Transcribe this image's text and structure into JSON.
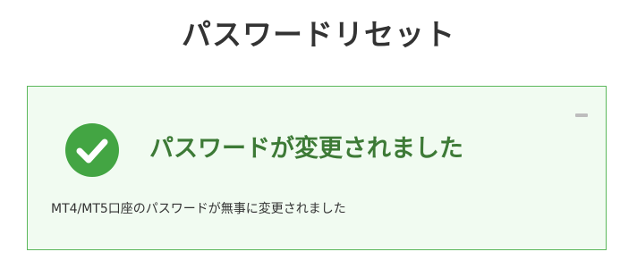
{
  "page": {
    "title": "パスワードリセット"
  },
  "alert": {
    "status": "success",
    "icon": "check-circle-icon",
    "heading": "パスワードが変更されました",
    "message": "MT4/MT5口座のパスワードが無事に変更されました",
    "minimize_icon": "minus-icon"
  },
  "colors": {
    "title": "#333333",
    "success_green": "#43a543",
    "heading_green": "#3d7a36",
    "border_green": "#5cb85c",
    "box_background": "#f1fbf1"
  }
}
